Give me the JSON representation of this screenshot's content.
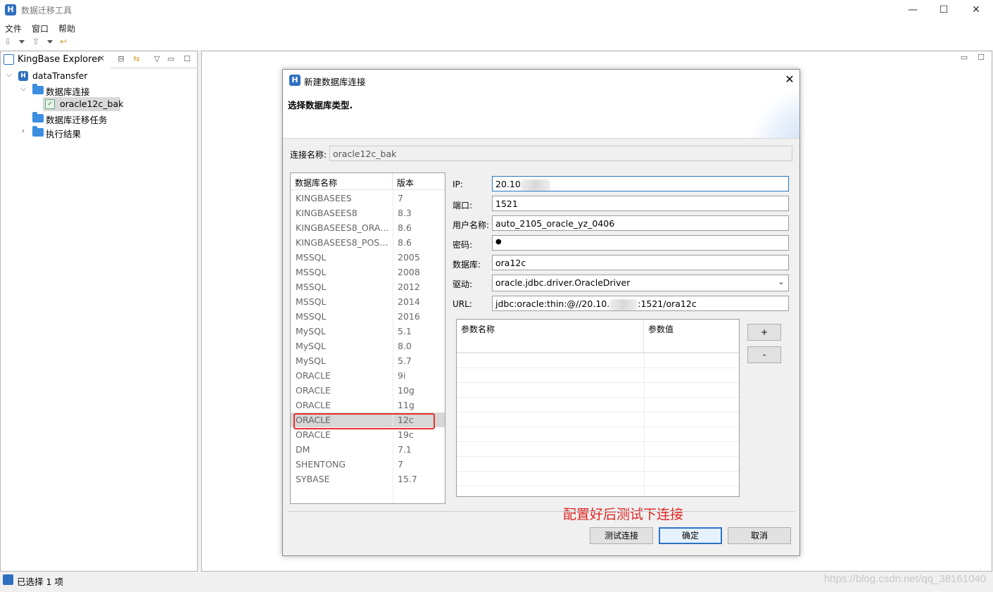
{
  "window": {
    "title": "数据迁移工具",
    "minimize": "—",
    "maximize": "☐",
    "close": "✕"
  },
  "menu": [
    "文件",
    "窗口",
    "帮助"
  ],
  "explorer": {
    "tab_label": "KingBase Explorer",
    "tree": {
      "root": "dataTransfer",
      "db_connections": "数据库连接",
      "connection_item": "oracle12c_bak",
      "migration_tasks": "数据库迁移任务",
      "exec_results": "执行结果"
    }
  },
  "status": {
    "text": "已选择 1 项"
  },
  "watermark": "https://blog.csdn.net/qq_38161040",
  "dialog": {
    "title": "新建数据库连接",
    "subtitle": "选择数据库类型.",
    "conn_name_label": "连接名称:",
    "conn_name_value": "oracle12c_bak",
    "db_table": {
      "headers": [
        "数据库名称",
        "版本"
      ],
      "rows": [
        [
          "KINGBASEES",
          "7"
        ],
        [
          "KINGBASEES8",
          "8.3"
        ],
        [
          "KINGBASEES8_ORACLE",
          "8.6"
        ],
        [
          "KINGBASEES8_POSTGRES",
          "8.6"
        ],
        [
          "MSSQL",
          "2005"
        ],
        [
          "MSSQL",
          "2008"
        ],
        [
          "MSSQL",
          "2012"
        ],
        [
          "MSSQL",
          "2014"
        ],
        [
          "MSSQL",
          "2016"
        ],
        [
          "MySQL",
          "5.1"
        ],
        [
          "MySQL",
          "8.0"
        ],
        [
          "MySQL",
          "5.7"
        ],
        [
          "ORACLE",
          "9i"
        ],
        [
          "ORACLE",
          "10g"
        ],
        [
          "ORACLE",
          "11g"
        ],
        [
          "ORACLE",
          "12c"
        ],
        [
          "ORACLE",
          "19c"
        ],
        [
          "DM",
          "7.1"
        ],
        [
          "SHENTONG",
          "7"
        ],
        [
          "SYBASE",
          "15.7"
        ]
      ],
      "selected_index": 15
    },
    "form": {
      "ip_label": "IP:",
      "ip_value": "20.10",
      "port_label": "端口:",
      "port_value": "1521",
      "user_label": "用户名称:",
      "user_value": "auto_2105_oracle_yz_0406",
      "pwd_label": "密码:",
      "pwd_value": "●",
      "db_label": "数据库:",
      "db_value": "ora12c",
      "driver_label": "驱动:",
      "driver_value": "oracle.jdbc.driver.OracleDriver",
      "url_label": "URL:",
      "url_prefix": "jdbc:oracle:thin:@//20.10.",
      "url_suffix": ":1521/ora12c"
    },
    "param_table": {
      "headers": [
        "参数名称",
        "参数值"
      ]
    },
    "add_btn": "+",
    "remove_btn": "-",
    "annotation": "配置好后测试下连接",
    "buttons": {
      "test": "测试连接",
      "ok": "确定",
      "cancel": "取消"
    }
  }
}
